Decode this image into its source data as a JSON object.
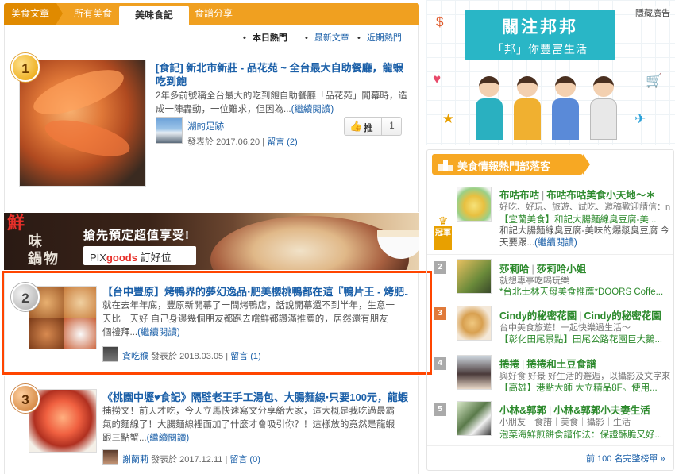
{
  "tabs": {
    "home": "美食文章",
    "all": "所有美食",
    "mine": "美味食記",
    "recipe": "食譜分享"
  },
  "subnav": {
    "hot": "本日熱門",
    "latest": "最新文章",
    "recent": "近期熱門"
  },
  "articles": [
    {
      "rank": "1",
      "title": "[食記] 新北市新莊 - 品花苑 ~ 全台最大自助餐廳，龍蝦吃到飽",
      "excerpt": "2年多前號稱全台最大的吃到飽自助餐廳「品花苑」開幕時，造成一陣轟動，一位難求，但因為...",
      "readmore": "(繼續閱讀)",
      "author": "湖的足跡",
      "posted_prefix": "發表於",
      "date": "2017.06.20",
      "separator": "|",
      "comments": "留言 (2)"
    },
    {
      "rank": "2",
      "title": "【台中豐原】烤鴨界的夢幻逸品‧肥美櫻桃鴨都在這『鴨片王 - 烤肥...",
      "excerpt": "就在去年年底，豐原新開幕了一間烤鴨店，話說開幕還不到半年，生意一天比一天好 自己身邊幾個朋友都跑去嚐鮮都讚滿推薦的，居然還有朋友一個禮拜...",
      "readmore": "(繼續閱讀)",
      "author": "貪吃猴",
      "posted_prefix": "發表於",
      "date": "2018.03.05",
      "separator": "|",
      "comments": "留言 (1)"
    },
    {
      "rank": "3",
      "title": "《桃園中壢♥食記》隔壁老王手工湯包、大腸麵線‧只要100元，龍蝦...",
      "excerpt": "捕撈文！前天才吃，今天立馬快速寫文分享給大家，這大概是我吃過最霸氣的麵線了！大腸麵線裡面加了什麼才會吸引你？！這樣放的竟然是龍蝦跟三點蟹...",
      "readmore": "(繼續閱讀)",
      "author": "謝蘭莉",
      "posted_prefix": "發表於",
      "date": "2017.12.11",
      "separator": "|",
      "comments": "留言 (0)"
    }
  ],
  "push_button": {
    "icon": "thumbs-up-icon",
    "label": "推",
    "count": "1"
  },
  "ad": {
    "brand_top": "鮮",
    "brand_bottom": "味 鍋物",
    "headline": "搶先預定超值享受!",
    "logo_pix": "PIX",
    "logo_goods": "goods",
    "logo_suffix": " 訂好位"
  },
  "promo": {
    "title": "關注邦邦",
    "subtitle": "「邦」你豐富生活",
    "close": "隱藏廣告"
  },
  "bloggers_panel": {
    "heading": "美食情報熱門部落客",
    "crown_label": "冠軍",
    "more": "前 100 名完整榜單 »",
    "items": [
      {
        "rank": "1",
        "name": "布咕布咕",
        "blog": "布咕布咕美食小天地～＊",
        "desc": "好吃、好玩、旅遊、試吃、邀稿歡迎請信：nixo...",
        "post_line1": "【宜蘭美食】和記大腸麵線臭豆腐-美...",
        "post_line2": "和記大腸麵線臭豆腐-美味的爆漿臭豆腐 今天要跟...",
        "readmore": "(繼續閱讀)"
      },
      {
        "rank": "2",
        "name": "莎莉哈",
        "blog": "莎莉哈小姐",
        "desc": "就想專亭吃喝玩樂",
        "post_line1": "*台北士林天母美食推薦*DOORS Coffe..."
      },
      {
        "rank": "3",
        "name": "Cindy的秘密花園",
        "blog": "Cindy的秘密花園",
        "desc": "台中美食旅遊！一起快樂過生活～",
        "post_line1": "【彰化田尾景點】田尾公路花園巨大鵝..."
      },
      {
        "rank": "4",
        "name": "捲捲",
        "blog": "捲捲和土豆食譜",
        "desc": "與好食 好景 好生活的邂逅，以攝影及文字來分...",
        "post_line1": "【高雄】港點大師 大立精品8F。使用..."
      },
      {
        "rank": "5",
        "name": "小林&郭郭",
        "blog": "小林&郭郭小夫妻生活",
        "desc": "小朋友｜食譜｜美食｜攝影｜生活",
        "post_line1": "泡菜海鮮煎餅食譜作法：保證酥脆又好..."
      }
    ]
  },
  "colors": {
    "accent_orange": "#f0a020",
    "link_blue": "#1a5fa8",
    "highlight_red": "#ff4500",
    "blogger_green": "#2d8a2d",
    "promo_teal": "#29b6c6"
  }
}
